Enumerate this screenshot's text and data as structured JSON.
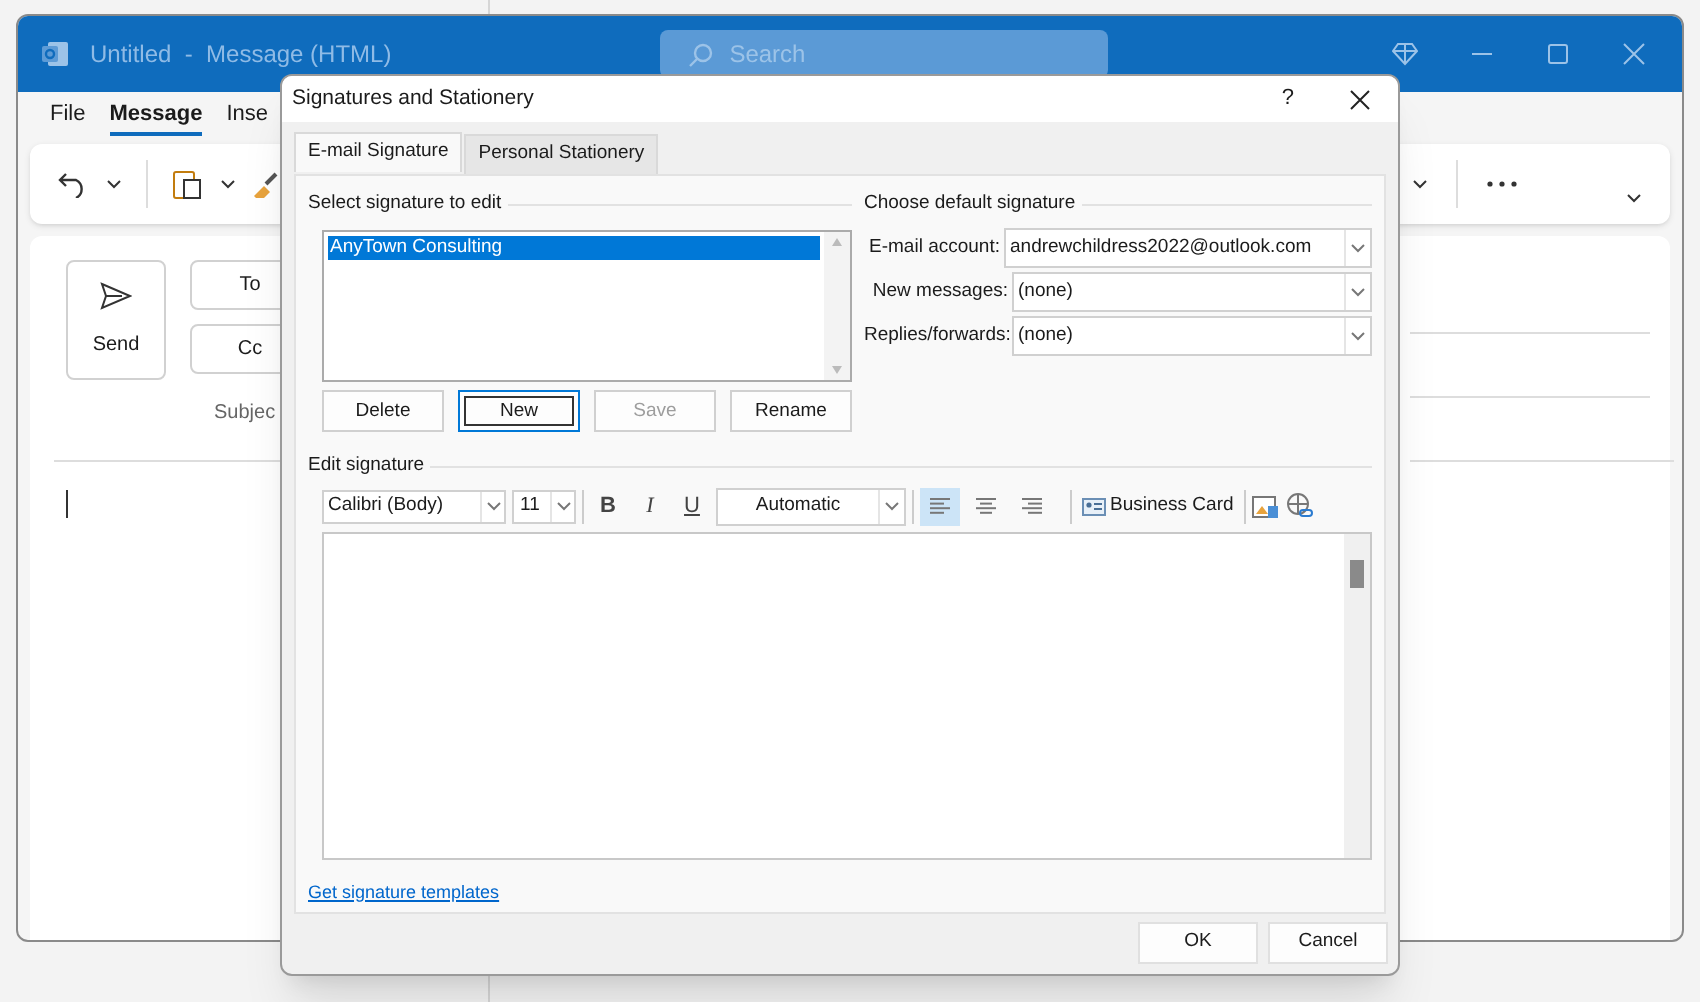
{
  "app": {
    "title": "Untitled  -  Message (HTML)",
    "search_placeholder": "Search",
    "menu": [
      {
        "label": "File",
        "selected": false
      },
      {
        "label": "Message",
        "selected": true
      },
      {
        "label": "Inse",
        "selected": false
      }
    ],
    "compose": {
      "send": "Send",
      "to": "To",
      "cc": "Cc",
      "subject": "Subjec"
    }
  },
  "dialog": {
    "title": "Signatures and Stationery",
    "help": "?",
    "tabs": [
      {
        "label": "E-mail Signature",
        "selected": true
      },
      {
        "label": "Personal Stationery",
        "selected": false
      }
    ],
    "select_label": "Select signature to edit",
    "signatures": [
      {
        "name": "AnyTown Consulting",
        "selected": true
      }
    ],
    "buttons": [
      {
        "label": "Delete",
        "disabled": false,
        "focused": false
      },
      {
        "label": "New",
        "disabled": false,
        "focused": true
      },
      {
        "label": "Save",
        "disabled": true,
        "focused": false
      },
      {
        "label": "Rename",
        "disabled": false,
        "focused": false
      }
    ],
    "default_label": "Choose default signature",
    "defaults": [
      {
        "label": "E-mail account:",
        "value": "andrewchildress2022@outlook.com"
      },
      {
        "label": "New messages:",
        "value": "(none)"
      },
      {
        "label": "Replies/forwards:",
        "value": "(none)"
      }
    ],
    "edit_label": "Edit signature",
    "toolbar": {
      "font": "Calibri (Body)",
      "size": "11",
      "format": [
        "B",
        "I",
        "U"
      ],
      "color_label": "Automatic",
      "align": [
        {
          "kind": "left",
          "selected": true
        },
        {
          "kind": "center",
          "selected": false
        },
        {
          "kind": "right",
          "selected": false
        }
      ],
      "business_card": "Business Card"
    },
    "templates_link": "Get signature templates",
    "ok": "OK",
    "cancel": "Cancel"
  }
}
